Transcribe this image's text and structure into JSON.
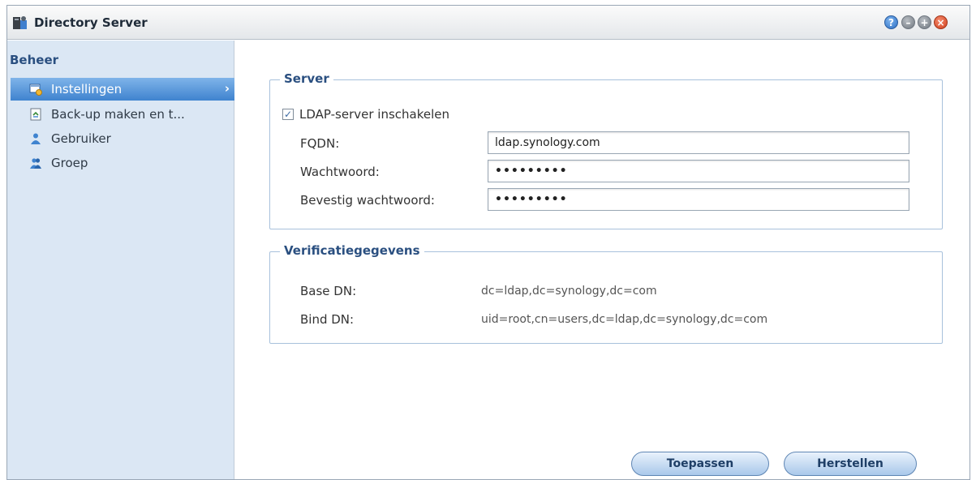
{
  "window": {
    "title": "Directory Server",
    "controls": [
      "help-icon",
      "minimize-icon",
      "maximize-icon",
      "close-icon"
    ]
  },
  "sidebar": {
    "header": "Beheer",
    "items": [
      {
        "label": "Instellingen",
        "icon": "settings-icon",
        "active": true
      },
      {
        "label": "Back-up maken en t...",
        "icon": "backup-icon",
        "active": false
      },
      {
        "label": "Gebruiker",
        "icon": "user-icon",
        "active": false
      },
      {
        "label": "Groep",
        "icon": "group-icon",
        "active": false
      }
    ]
  },
  "server": {
    "legend": "Server",
    "enable_label": "LDAP-server inschakelen",
    "enable_checked": true,
    "fqdn_label": "FQDN:",
    "fqdn_value": "ldap.synology.com",
    "password_label": "Wachtwoord:",
    "password_value": "•••••••••",
    "confirm_label": "Bevestig wachtwoord:",
    "confirm_value": "•••••••••"
  },
  "verification": {
    "legend": "Verificatiegegevens",
    "base_dn_label": "Base DN:",
    "base_dn_value": "dc=ldap,dc=synology,dc=com",
    "bind_dn_label": "Bind DN:",
    "bind_dn_value": "uid=root,cn=users,dc=ldap,dc=synology,dc=com"
  },
  "actions": {
    "apply_label": "Toepassen",
    "reset_label": "Herstellen"
  },
  "colors": {
    "accent": "#3f83cf",
    "sidebar_bg": "#dbe7f4",
    "legend_text": "#2a4f80"
  }
}
